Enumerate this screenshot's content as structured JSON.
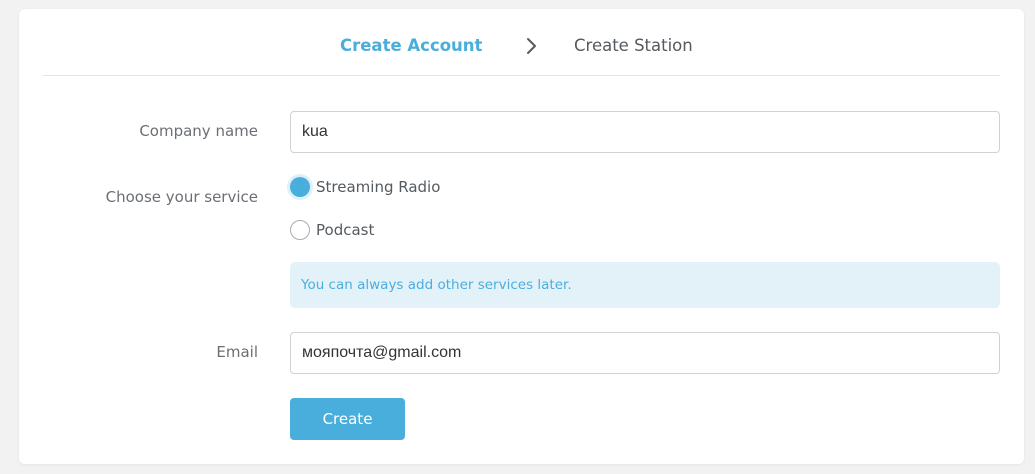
{
  "steps": {
    "active_label": "Create Account",
    "inactive_label": "Create Station",
    "separator_icon": "chevron-right-icon"
  },
  "form": {
    "company": {
      "label": "Company name",
      "value": "kua"
    },
    "service": {
      "label": "Choose your service",
      "options": [
        {
          "label": "Streaming Radio",
          "selected": true
        },
        {
          "label": "Podcast",
          "selected": false
        }
      ],
      "info": "You can always add other services later."
    },
    "email": {
      "label": "Email",
      "value": "мояпочта@gmail.com"
    },
    "submit_label": "Create"
  },
  "colors": {
    "accent": "#4aaedd",
    "info_bg": "#e3f2f9",
    "text": "#555a5f",
    "page_bg": "#f2f2f3"
  }
}
